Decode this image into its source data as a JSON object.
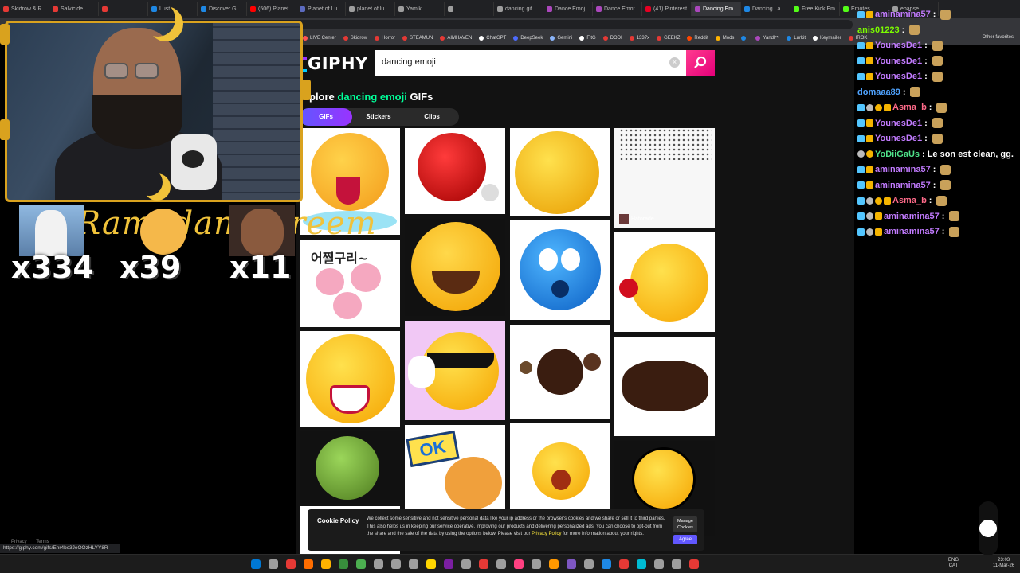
{
  "browser": {
    "tabs": [
      {
        "label": "Skidrow & R",
        "color": "#e53935"
      },
      {
        "label": "Salvicide",
        "color": "#e53935"
      },
      {
        "label": "",
        "color": "#e53935"
      },
      {
        "label": "Lust",
        "color": "#1e88e5"
      },
      {
        "label": "Discover Gi",
        "color": "#1e88e5"
      },
      {
        "label": "(506) Planet",
        "color": "#ff0000"
      },
      {
        "label": "Planet of Lu",
        "color": "#5c6bc0"
      },
      {
        "label": "planet of lu",
        "color": "#9e9e9e"
      },
      {
        "label": "Yamlk",
        "color": "#9e9e9e"
      },
      {
        "label": "",
        "color": "#9e9e9e"
      },
      {
        "label": "dancing gif",
        "color": "#9e9e9e"
      },
      {
        "label": "Dance Emoj",
        "color": "#ab47bc"
      },
      {
        "label": "Dance Emot",
        "color": "#ab47bc"
      },
      {
        "label": "(41) Pinterest",
        "color": "#e60023"
      },
      {
        "label": "Dancing Em",
        "color": "#ab47bc",
        "active": true
      },
      {
        "label": "Dancing La",
        "color": "#1e88e5"
      },
      {
        "label": "Free Kick Em",
        "color": "#53fc18"
      },
      {
        "label": "Emotes",
        "color": "#53fc18"
      },
      {
        "label": "ebapse",
        "color": "#9e9e9e"
      }
    ],
    "url": "giphy.com/explore/dancing-emoji",
    "bookmarks": [
      {
        "label": "LIVE Center",
        "color": "#ff5252"
      },
      {
        "label": "Skidrow",
        "color": "#e53935"
      },
      {
        "label": "Horror",
        "color": "#e53935"
      },
      {
        "label": "STEAMUN",
        "color": "#e53935"
      },
      {
        "label": "AIMHAVEN",
        "color": "#e53935"
      },
      {
        "label": "ChatGPT",
        "color": "#ffffff"
      },
      {
        "label": "DeepSeek",
        "color": "#4d6bfe"
      },
      {
        "label": "Gemini",
        "color": "#8ab4f8"
      },
      {
        "label": "FitG",
        "color": "#ffffff"
      },
      {
        "label": "DODI",
        "color": "#e53935"
      },
      {
        "label": "1337x",
        "color": "#e53935"
      },
      {
        "label": "GEEKZ",
        "color": "#e53935"
      },
      {
        "label": "Reddit",
        "color": "#ff4500"
      },
      {
        "label": "Mods",
        "color": "#ffb300"
      },
      {
        "label": "",
        "color": "#1e88e5"
      },
      {
        "label": "Yandl™",
        "color": "#ab47bc"
      },
      {
        "label": "Lurkit",
        "color": "#1e88e5"
      },
      {
        "label": "Keymailer",
        "color": "#ffffff"
      },
      {
        "label": "IROK",
        "color": "#e53935"
      }
    ],
    "other_favorites": "Other favorites",
    "status_url": "https://giphy.com/gifs/Enr4bc3JeOOzHLYY8R"
  },
  "giphy": {
    "logo": "GIPHY",
    "search_value": "dancing emoji",
    "explore_prefix": "plore",
    "explore_highlight": "dancing emoji",
    "explore_suffix": "GIFs",
    "filters": [
      "GIFs",
      "Stickers",
      "Clips"
    ],
    "active_filter": "GIFs",
    "tile_credit": "Hatorade",
    "tile_caption_korean": "어쩔구리~",
    "tile_caption_ok": "OK",
    "cookie": {
      "title": "Cookie Policy",
      "text": "We collect some sensitive and not sensitive personal data like your ip address or the browser's cookies and we share or sell it to third parties. This also helps us in keeping our service operative, improving our products and delivering personalized ads. You can choose to opt-out from the share and the sale of the data by using the options below. Please visit our",
      "link": "Privacy Policy",
      "text_after": "for more information about your rights.",
      "manage": "Manage Cookies",
      "agree": "Agree"
    },
    "footer": [
      "Privacy",
      "Terms"
    ]
  },
  "overlay": {
    "banner": "Ramadan Kareem",
    "counts": [
      "x334",
      "x39",
      "x11"
    ]
  },
  "chat": {
    "messages": [
      {
        "user": "aminamina57",
        "color": "#c27bff",
        "badges": [
          "blue",
          "crown"
        ],
        "text": "",
        "emote": true
      },
      {
        "user": "anis01223",
        "color": "#7cfc00",
        "badges": [],
        "text": "",
        "emote": true
      },
      {
        "user": "YounesDe1",
        "color": "#c27bff",
        "badges": [
          "blue",
          "crown"
        ],
        "text": "",
        "emote": true
      },
      {
        "user": "YounesDe1",
        "color": "#c27bff",
        "badges": [
          "blue",
          "crown"
        ],
        "text": "",
        "emote": true
      },
      {
        "user": "YounesDe1",
        "color": "#c27bff",
        "badges": [
          "blue",
          "crown"
        ],
        "text": "",
        "emote": true
      },
      {
        "user": "domaaa89",
        "color": "#4fa3ff",
        "badges": [],
        "text": "",
        "emote": true
      },
      {
        "user": "Asma_b",
        "color": "#ff6b8a",
        "badges": [
          "blue",
          "grey",
          "gold",
          "crown"
        ],
        "text": "",
        "emote": true
      },
      {
        "user": "YounesDe1",
        "color": "#c27bff",
        "badges": [
          "blue",
          "crown"
        ],
        "text": "",
        "emote": true
      },
      {
        "user": "YounesDe1",
        "color": "#c27bff",
        "badges": [
          "blue",
          "crown"
        ],
        "text": "",
        "emote": true
      },
      {
        "user": "YoDiiGaUs",
        "color": "#4fe38a",
        "badges": [
          "grey",
          "gold"
        ],
        "text": "Le son est clean, gg.",
        "emote": false
      },
      {
        "user": "aminamina57",
        "color": "#c27bff",
        "badges": [
          "blue",
          "crown"
        ],
        "text": "",
        "emote": true
      },
      {
        "user": "aminamina57",
        "color": "#c27bff",
        "badges": [
          "blue",
          "crown"
        ],
        "text": "",
        "emote": true
      },
      {
        "user": "Asma_b",
        "color": "#ff6b8a",
        "badges": [
          "blue",
          "grey",
          "gold",
          "crown"
        ],
        "text": "",
        "emote": true
      },
      {
        "user": "aminamina57",
        "color": "#c27bff",
        "badges": [
          "blue",
          "grey",
          "crown"
        ],
        "text": "",
        "emote": true
      },
      {
        "user": "aminamina57",
        "color": "#c27bff",
        "badges": [
          "blue",
          "grey",
          "crown"
        ],
        "text": "",
        "emote": true
      }
    ]
  },
  "taskbar": {
    "lang_top": "ENG",
    "lang_bottom": "CAT",
    "time": "23:03",
    "date": "11-Mar-26",
    "icons": [
      "#0078d4",
      "#9e9e9e",
      "#e53935",
      "#ff6d00",
      "#ffb300",
      "#388e3c",
      "#4caf50",
      "#9e9e9e",
      "#9e9e9e",
      "#9e9e9e",
      "#ffd600",
      "#7b1fa2",
      "#9e9e9e",
      "#e53935",
      "#9e9e9e",
      "#ff4081",
      "#9e9e9e",
      "#ff9800",
      "#7e57c2",
      "#9e9e9e",
      "#1e88e5",
      "#e53935",
      "#00bcd4",
      "#9e9e9e",
      "#9e9e9e",
      "#e53935"
    ]
  }
}
